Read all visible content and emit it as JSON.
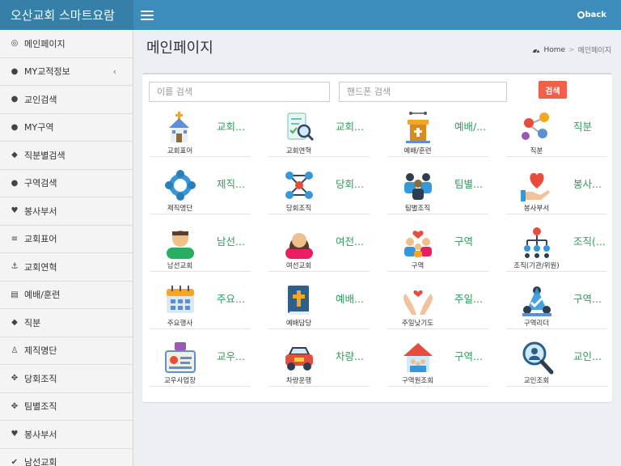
{
  "app": {
    "title": "오산교회 스마트요람",
    "back_label": "back"
  },
  "sidebar": {
    "items": [
      {
        "label": "메인페이지",
        "icon": "dashboard-icon",
        "glyph": "◎"
      },
      {
        "label": "MY교적정보",
        "icon": "user-icon",
        "glyph": "●",
        "chevron": "‹"
      },
      {
        "label": "교인검색",
        "icon": "user-icon",
        "glyph": "●"
      },
      {
        "label": "MY구역",
        "icon": "user-icon",
        "glyph": "●"
      },
      {
        "label": "직분별검색",
        "icon": "tags-icon",
        "glyph": "◆"
      },
      {
        "label": "구역검색",
        "icon": "user-icon",
        "glyph": "●"
      },
      {
        "label": "봉사부서",
        "icon": "heart-icon",
        "glyph": "♥"
      },
      {
        "label": "교회표어",
        "icon": "list-icon",
        "glyph": "≡"
      },
      {
        "label": "교회연혁",
        "icon": "anchor-icon",
        "glyph": "⚓"
      },
      {
        "label": "예배/훈련",
        "icon": "newspaper-icon",
        "glyph": "▤"
      },
      {
        "label": "직분",
        "icon": "tags-icon",
        "glyph": "◆"
      },
      {
        "label": "제직명단",
        "icon": "child-icon",
        "glyph": "♙"
      },
      {
        "label": "당회조직",
        "icon": "arrows-icon",
        "glyph": "✥"
      },
      {
        "label": "팀별조직",
        "icon": "arrows-icon",
        "glyph": "✥"
      },
      {
        "label": "봉사부서",
        "icon": "heart-icon",
        "glyph": "♥"
      },
      {
        "label": "남선교회",
        "icon": "check-circle-icon",
        "glyph": "✔"
      }
    ]
  },
  "main": {
    "title": "메인페이지",
    "breadcrumb": {
      "home": "Home",
      "current": "메인페이지"
    },
    "search": {
      "name_placeholder": "이름 검색",
      "phone_placeholder": "핸드폰 검색",
      "button": "검색"
    },
    "tiles": [
      {
        "caption": "교회표어",
        "title": "교회...",
        "icon": "church-icon"
      },
      {
        "caption": "교회연혁",
        "title": "교회...",
        "icon": "history-search-icon"
      },
      {
        "caption": "예배/훈련",
        "title": "예배/...",
        "icon": "pulpit-icon"
      },
      {
        "caption": "직분",
        "title": "직분",
        "icon": "network-people-icon"
      },
      {
        "caption": "제직명단",
        "title": "제직...",
        "icon": "circle-people-icon"
      },
      {
        "caption": "당회조직",
        "title": "당회...",
        "icon": "network-icon"
      },
      {
        "caption": "팀별조직",
        "title": "팀별...",
        "icon": "team-icon"
      },
      {
        "caption": "봉사부서",
        "title": "봉사...",
        "icon": "heart-hand-icon"
      },
      {
        "caption": "남선교회",
        "title": "남선...",
        "icon": "man-avatar-icon"
      },
      {
        "caption": "여선교회",
        "title": "여전...",
        "icon": "woman-avatar-icon"
      },
      {
        "caption": "구역",
        "title": "구역",
        "icon": "family-icon"
      },
      {
        "caption": "조직(기관/위원)",
        "title": "조직(...",
        "icon": "org-chart-icon"
      },
      {
        "caption": "주요행사",
        "title": "주요...",
        "icon": "calendar-icon"
      },
      {
        "caption": "예배담당",
        "title": "예배...",
        "icon": "bible-icon"
      },
      {
        "caption": "주일낮기도",
        "title": "주일...",
        "icon": "praying-hands-icon"
      },
      {
        "caption": "구역리더",
        "title": "구역...",
        "icon": "leader-icon"
      },
      {
        "caption": "교우사업장",
        "title": "교우...",
        "icon": "business-card-icon"
      },
      {
        "caption": "차량운행",
        "title": "차량...",
        "icon": "car-icon"
      },
      {
        "caption": "구역원조회",
        "title": "구역...",
        "icon": "house-group-icon"
      },
      {
        "caption": "교인조회",
        "title": "교인...",
        "icon": "magnifier-user-icon"
      }
    ]
  },
  "colors": {
    "header": "#3c8dbc",
    "logo_bg": "#367fa9",
    "sidebar_bg": "#f4f4f4",
    "tile_title": "#2e9c5a",
    "search_button": "#f0604a"
  }
}
